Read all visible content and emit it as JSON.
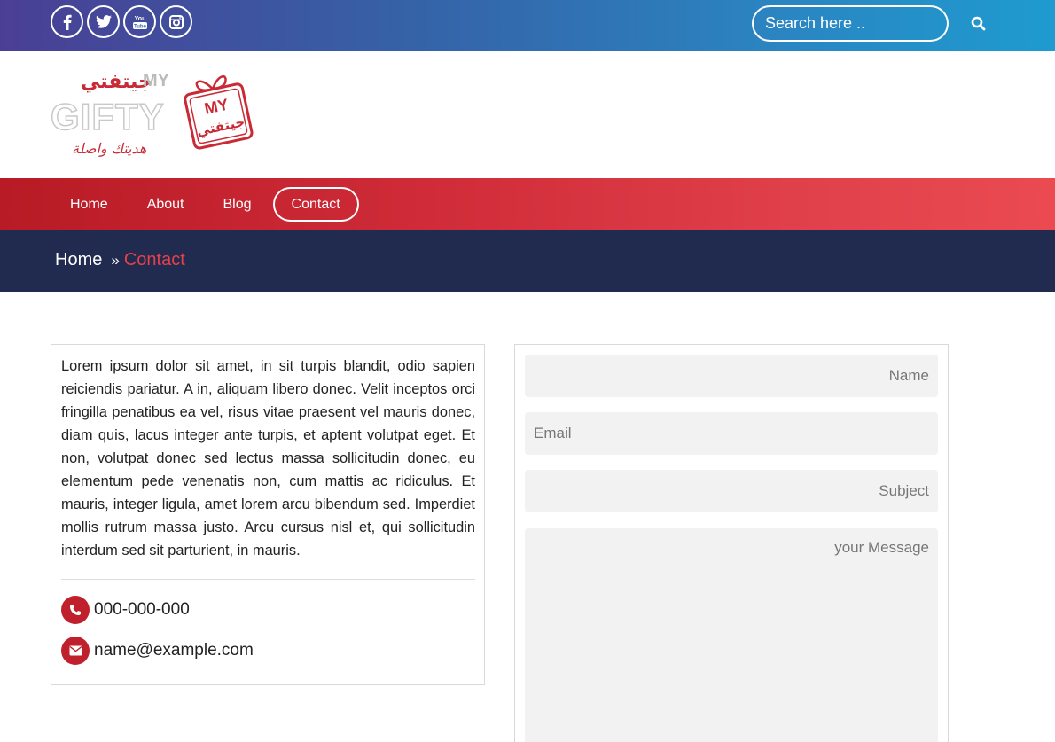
{
  "topbar": {
    "social": [
      {
        "icon": "facebook-icon"
      },
      {
        "icon": "twitter-icon"
      },
      {
        "icon": "youtube-icon",
        "label_top": "You",
        "label_bottom": "Tube"
      },
      {
        "icon": "instagram-icon"
      }
    ],
    "search": {
      "placeholder": "Search here ..",
      "icon": "search-icon"
    }
  },
  "logo": {
    "arabic_top": "جيتفتي",
    "my": "MY",
    "gifty": "GIFTY",
    "arabic_bottom": "هديتك واصلة",
    "box_my": "MY",
    "box_arabic": "جيتفتي"
  },
  "nav": {
    "items": [
      {
        "label": "Home"
      },
      {
        "label": "About"
      },
      {
        "label": "Blog"
      },
      {
        "label": "Contact",
        "active": true
      }
    ]
  },
  "breadcrumb": {
    "home": "Home",
    "separator": "»",
    "current": "Contact"
  },
  "info": {
    "paragraph": "Lorem ipsum dolor sit amet, in sit turpis blandit, odio sapien reiciendis pariatur. A in, aliquam libero donec. Velit inceptos orci fringilla penatibus ea vel, risus vitae praesent vel mauris donec, diam quis, lacus integer ante turpis, et aptent volutpat eget. Et non, volutpat donec sed lectus massa sollicitudin donec, eu elementum pede venenatis non, cum mattis ac ridiculus. Et mauris, integer ligula, amet lorem arcu bibendum sed. Imperdiet mollis rutrum massa justo. Arcu cursus nisl et, qui sollicitudin interdum sed sit parturient, in mauris.",
    "phone": "000-000-000",
    "email": "name@example.com"
  },
  "form": {
    "name_placeholder": "Name",
    "email_placeholder": "Email",
    "subject_placeholder": "Subject",
    "message_placeholder": "your Message"
  },
  "colors": {
    "topbar_start": "#4a3f95",
    "topbar_end": "#1e9bd0",
    "nav_red": "#cf2b38",
    "breadcrumb_bg": "#212a4f",
    "accent": "#e5414b",
    "icon_red": "#c0202b"
  }
}
